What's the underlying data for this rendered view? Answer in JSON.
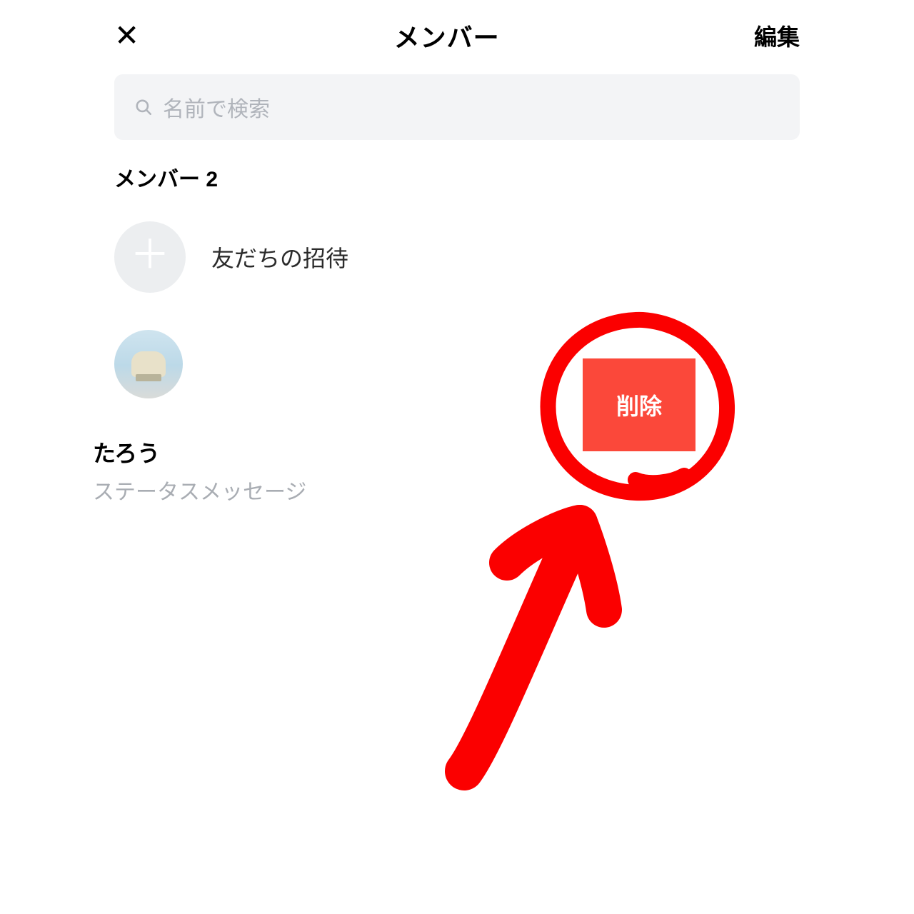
{
  "header": {
    "close_glyph": "✕",
    "title": "メンバー",
    "edit_label": "編集"
  },
  "search": {
    "placeholder": "名前で検索"
  },
  "section": {
    "label": "メンバー 2"
  },
  "invite": {
    "label": "友だちの招待",
    "plus_glyph": "＋"
  },
  "member": {
    "name": "たろう",
    "status": "ステータスメッセージ"
  },
  "delete_button": {
    "label": "削除"
  },
  "annotation": {
    "circle_color": "#fb0000",
    "arrow_color": "#fb0000"
  }
}
